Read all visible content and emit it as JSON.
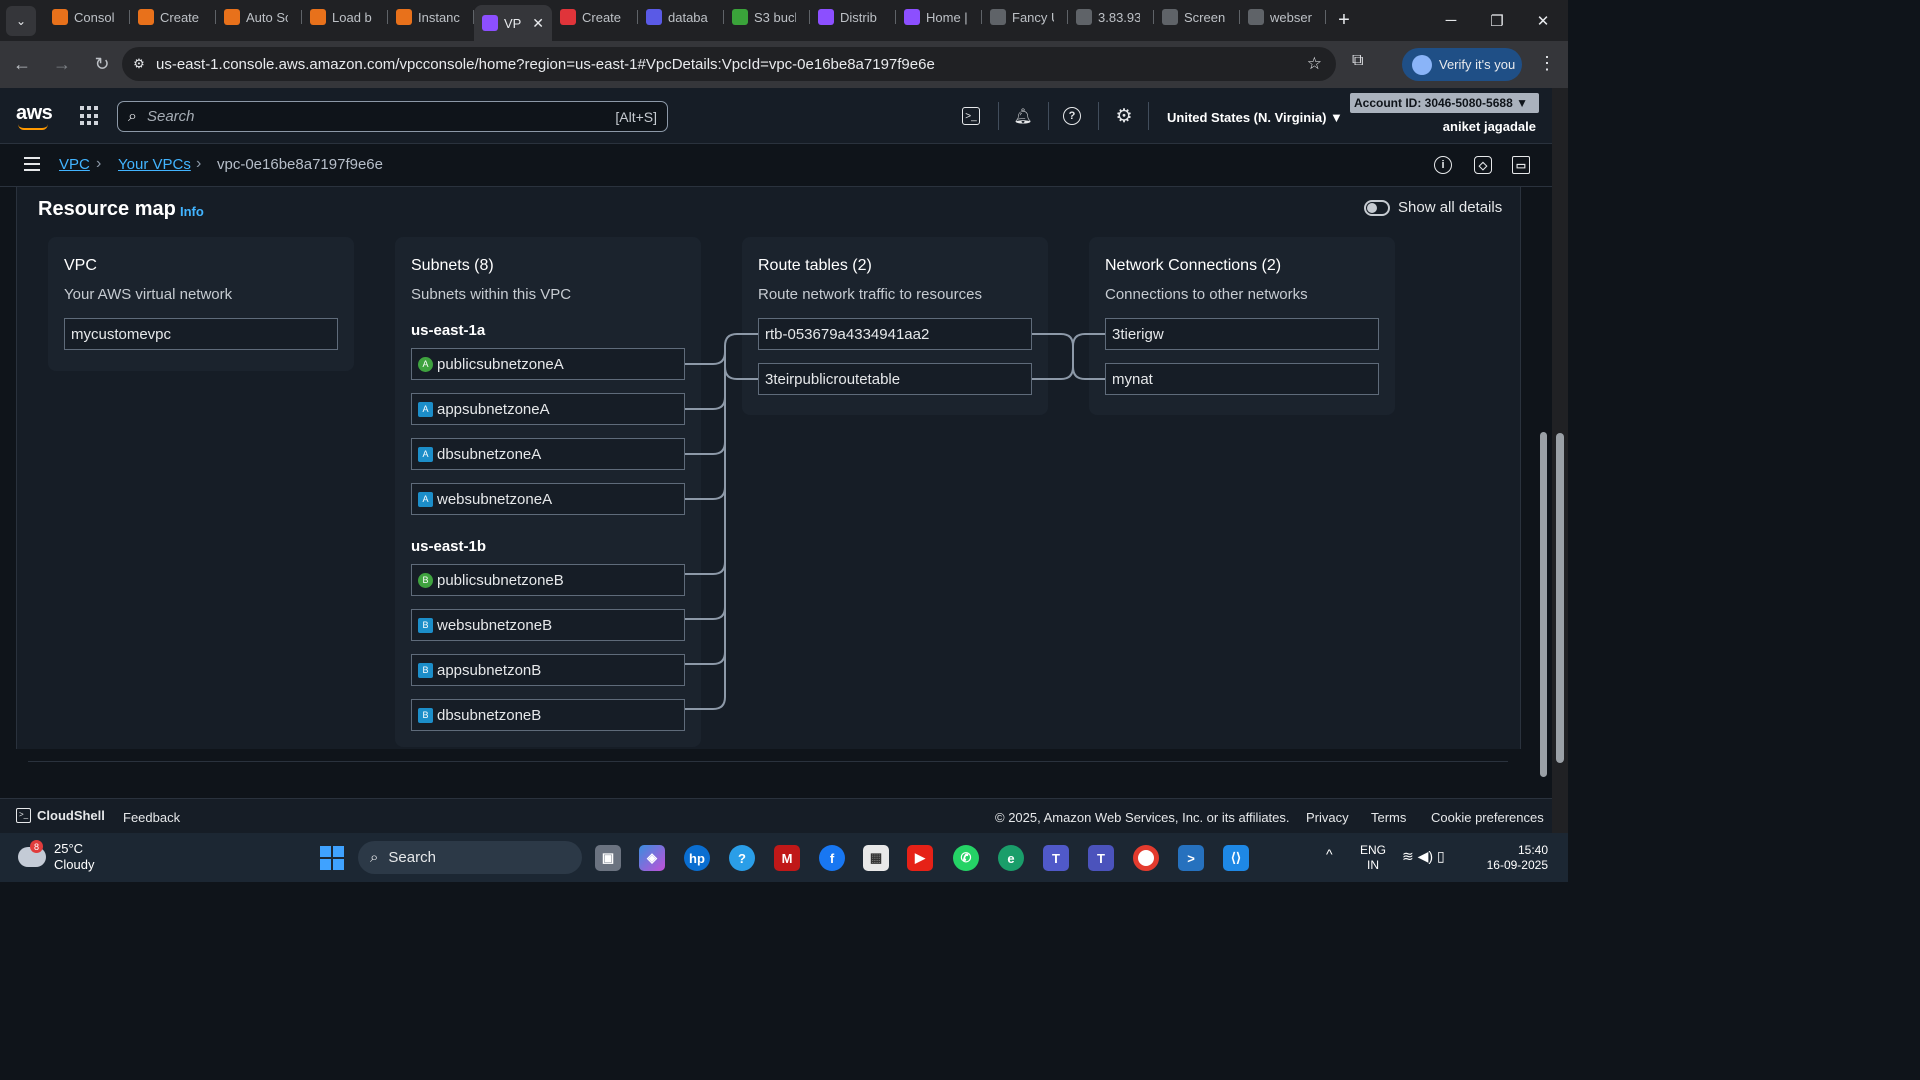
{
  "browser": {
    "tabs": [
      {
        "label": "Consol",
        "icon": "aws-console-icon",
        "color": "#e8711b"
      },
      {
        "label": "Create",
        "icon": "aws-console-icon",
        "color": "#e8711b"
      },
      {
        "label": "Auto Sc",
        "icon": "aws-console-icon",
        "color": "#e8711b"
      },
      {
        "label": "Load b",
        "icon": "aws-console-icon",
        "color": "#e8711b"
      },
      {
        "label": "Instanc",
        "icon": "aws-console-icon",
        "color": "#e8711b"
      },
      {
        "label": "VP",
        "icon": "vpc-icon",
        "color": "#8c4fff",
        "active": true
      },
      {
        "label": "Create",
        "icon": "rds-icon",
        "color": "#e0343a"
      },
      {
        "label": "databa",
        "icon": "database-icon",
        "color": "#5a5ae6"
      },
      {
        "label": "S3 buck",
        "icon": "s3-icon",
        "color": "#3aa33a"
      },
      {
        "label": "Distrib",
        "icon": "cloudfront-icon",
        "color": "#8c4fff"
      },
      {
        "label": "Home |",
        "icon": "vpc-icon",
        "color": "#8c4fff"
      },
      {
        "label": "Fancy U",
        "icon": "globe-icon",
        "color": "#5f6368"
      },
      {
        "label": "3.83.93",
        "icon": "globe-icon",
        "color": "#5f6368"
      },
      {
        "label": "Screen",
        "icon": "globe-icon",
        "color": "#5f6368"
      },
      {
        "label": "webser",
        "icon": "globe-icon",
        "color": "#5f6368"
      }
    ],
    "url": "us-east-1.console.aws.amazon.com/vpcconsole/home?region=us-east-1#VpcDetails:VpcId=vpc-0e16be8a7197f9e6e",
    "verify_label": "Verify it's you"
  },
  "aws_header": {
    "logo_text": "aws",
    "search_placeholder": "Search",
    "search_shortcut": "[Alt+S]",
    "region": "United States (N. Virginia) ▼",
    "account": "Account ID: 3046-5080-5688 ▼",
    "user": "aniket jagadale"
  },
  "breadcrumb": {
    "items": [
      "VPC",
      "Your VPCs"
    ],
    "current": "vpc-0e16be8a7197f9e6e"
  },
  "resource_map": {
    "title": "Resource map",
    "info": "Info",
    "toggle_label": "Show all details",
    "vpc": {
      "title": "VPC",
      "subtitle": "Your AWS virtual network",
      "name": "mycustomevpc"
    },
    "subnets": {
      "title": "Subnets (8)",
      "subtitle": "Subnets within this VPC",
      "zones": [
        {
          "name": "us-east-1a",
          "items": [
            {
              "name": "publicsubnetzoneA",
              "badge": "A",
              "public": true
            },
            {
              "name": "appsubnetzoneA",
              "badge": "A",
              "public": false
            },
            {
              "name": "dbsubnetzoneA",
              "badge": "A",
              "public": false
            },
            {
              "name": "websubnetzoneA",
              "badge": "A",
              "public": false
            }
          ]
        },
        {
          "name": "us-east-1b",
          "items": [
            {
              "name": "publicsubnetzoneB",
              "badge": "B",
              "public": true
            },
            {
              "name": "websubnetzoneB",
              "badge": "B",
              "public": false
            },
            {
              "name": "appsubnetzonB",
              "badge": "B",
              "public": false
            },
            {
              "name": "dbsubnetzoneB",
              "badge": "B",
              "public": false
            }
          ]
        }
      ]
    },
    "route_tables": {
      "title": "Route tables (2)",
      "subtitle": "Route network traffic to resources",
      "items": [
        "rtb-053679a4334941aa2",
        "3teirpublicroutetable"
      ]
    },
    "network_connections": {
      "title": "Network Connections (2)",
      "subtitle": "Connections to other networks",
      "items": [
        "3tierigw",
        "mynat"
      ]
    }
  },
  "footer": {
    "cloudshell": "CloudShell",
    "feedback": "Feedback",
    "copyright": "© 2025, Amazon Web Services, Inc. or its affiliates.",
    "privacy": "Privacy",
    "terms": "Terms",
    "cookies": "Cookie preferences"
  },
  "taskbar": {
    "weather_temp": "25°C",
    "weather_desc": "Cloudy",
    "weather_badge": "8",
    "search_label": "Search",
    "lang_1": "ENG",
    "lang_2": "IN",
    "time": "15:40",
    "date": "16-09-2025"
  }
}
